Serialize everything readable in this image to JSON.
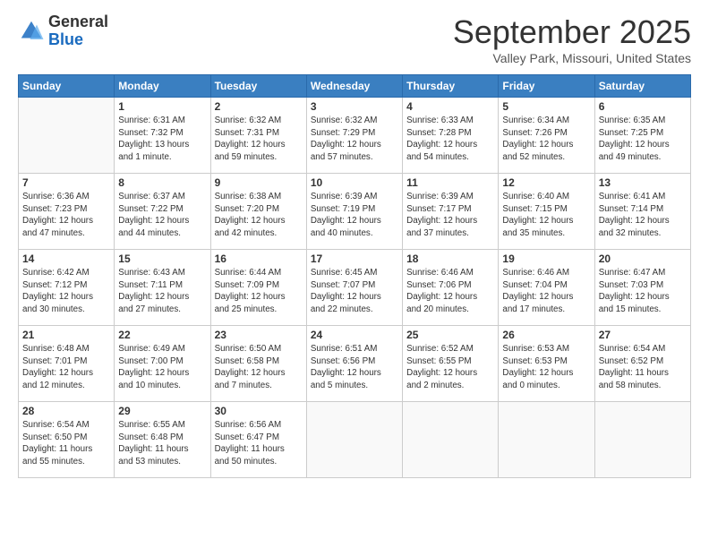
{
  "header": {
    "logo_line1": "General",
    "logo_line2": "Blue",
    "month": "September 2025",
    "location": "Valley Park, Missouri, United States"
  },
  "weekdays": [
    "Sunday",
    "Monday",
    "Tuesday",
    "Wednesday",
    "Thursday",
    "Friday",
    "Saturday"
  ],
  "weeks": [
    [
      {
        "num": "",
        "info": ""
      },
      {
        "num": "1",
        "info": "Sunrise: 6:31 AM\nSunset: 7:32 PM\nDaylight: 13 hours\nand 1 minute."
      },
      {
        "num": "2",
        "info": "Sunrise: 6:32 AM\nSunset: 7:31 PM\nDaylight: 12 hours\nand 59 minutes."
      },
      {
        "num": "3",
        "info": "Sunrise: 6:32 AM\nSunset: 7:29 PM\nDaylight: 12 hours\nand 57 minutes."
      },
      {
        "num": "4",
        "info": "Sunrise: 6:33 AM\nSunset: 7:28 PM\nDaylight: 12 hours\nand 54 minutes."
      },
      {
        "num": "5",
        "info": "Sunrise: 6:34 AM\nSunset: 7:26 PM\nDaylight: 12 hours\nand 52 minutes."
      },
      {
        "num": "6",
        "info": "Sunrise: 6:35 AM\nSunset: 7:25 PM\nDaylight: 12 hours\nand 49 minutes."
      }
    ],
    [
      {
        "num": "7",
        "info": "Sunrise: 6:36 AM\nSunset: 7:23 PM\nDaylight: 12 hours\nand 47 minutes."
      },
      {
        "num": "8",
        "info": "Sunrise: 6:37 AM\nSunset: 7:22 PM\nDaylight: 12 hours\nand 44 minutes."
      },
      {
        "num": "9",
        "info": "Sunrise: 6:38 AM\nSunset: 7:20 PM\nDaylight: 12 hours\nand 42 minutes."
      },
      {
        "num": "10",
        "info": "Sunrise: 6:39 AM\nSunset: 7:19 PM\nDaylight: 12 hours\nand 40 minutes."
      },
      {
        "num": "11",
        "info": "Sunrise: 6:39 AM\nSunset: 7:17 PM\nDaylight: 12 hours\nand 37 minutes."
      },
      {
        "num": "12",
        "info": "Sunrise: 6:40 AM\nSunset: 7:15 PM\nDaylight: 12 hours\nand 35 minutes."
      },
      {
        "num": "13",
        "info": "Sunrise: 6:41 AM\nSunset: 7:14 PM\nDaylight: 12 hours\nand 32 minutes."
      }
    ],
    [
      {
        "num": "14",
        "info": "Sunrise: 6:42 AM\nSunset: 7:12 PM\nDaylight: 12 hours\nand 30 minutes."
      },
      {
        "num": "15",
        "info": "Sunrise: 6:43 AM\nSunset: 7:11 PM\nDaylight: 12 hours\nand 27 minutes."
      },
      {
        "num": "16",
        "info": "Sunrise: 6:44 AM\nSunset: 7:09 PM\nDaylight: 12 hours\nand 25 minutes."
      },
      {
        "num": "17",
        "info": "Sunrise: 6:45 AM\nSunset: 7:07 PM\nDaylight: 12 hours\nand 22 minutes."
      },
      {
        "num": "18",
        "info": "Sunrise: 6:46 AM\nSunset: 7:06 PM\nDaylight: 12 hours\nand 20 minutes."
      },
      {
        "num": "19",
        "info": "Sunrise: 6:46 AM\nSunset: 7:04 PM\nDaylight: 12 hours\nand 17 minutes."
      },
      {
        "num": "20",
        "info": "Sunrise: 6:47 AM\nSunset: 7:03 PM\nDaylight: 12 hours\nand 15 minutes."
      }
    ],
    [
      {
        "num": "21",
        "info": "Sunrise: 6:48 AM\nSunset: 7:01 PM\nDaylight: 12 hours\nand 12 minutes."
      },
      {
        "num": "22",
        "info": "Sunrise: 6:49 AM\nSunset: 7:00 PM\nDaylight: 12 hours\nand 10 minutes."
      },
      {
        "num": "23",
        "info": "Sunrise: 6:50 AM\nSunset: 6:58 PM\nDaylight: 12 hours\nand 7 minutes."
      },
      {
        "num": "24",
        "info": "Sunrise: 6:51 AM\nSunset: 6:56 PM\nDaylight: 12 hours\nand 5 minutes."
      },
      {
        "num": "25",
        "info": "Sunrise: 6:52 AM\nSunset: 6:55 PM\nDaylight: 12 hours\nand 2 minutes."
      },
      {
        "num": "26",
        "info": "Sunrise: 6:53 AM\nSunset: 6:53 PM\nDaylight: 12 hours\nand 0 minutes."
      },
      {
        "num": "27",
        "info": "Sunrise: 6:54 AM\nSunset: 6:52 PM\nDaylight: 11 hours\nand 58 minutes."
      }
    ],
    [
      {
        "num": "28",
        "info": "Sunrise: 6:54 AM\nSunset: 6:50 PM\nDaylight: 11 hours\nand 55 minutes."
      },
      {
        "num": "29",
        "info": "Sunrise: 6:55 AM\nSunset: 6:48 PM\nDaylight: 11 hours\nand 53 minutes."
      },
      {
        "num": "30",
        "info": "Sunrise: 6:56 AM\nSunset: 6:47 PM\nDaylight: 11 hours\nand 50 minutes."
      },
      {
        "num": "",
        "info": ""
      },
      {
        "num": "",
        "info": ""
      },
      {
        "num": "",
        "info": ""
      },
      {
        "num": "",
        "info": ""
      }
    ]
  ]
}
